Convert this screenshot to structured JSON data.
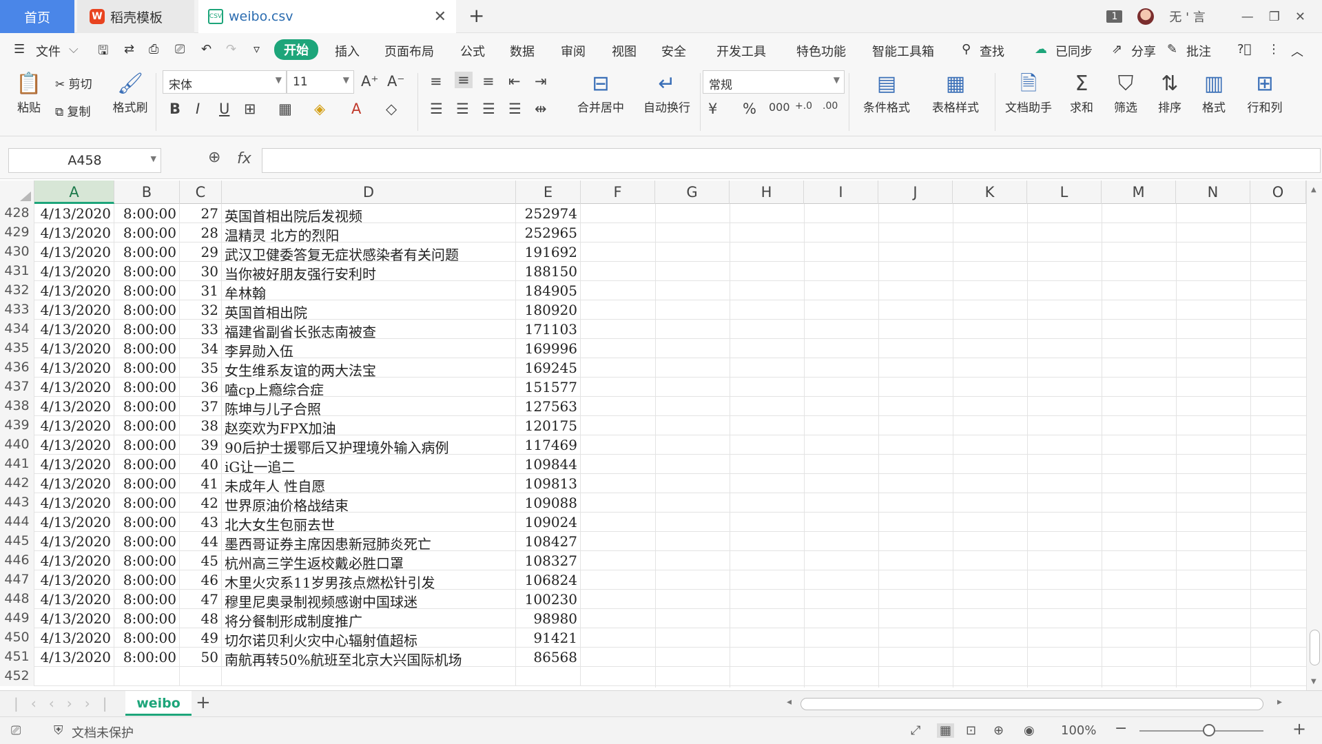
{
  "tabs": {
    "home": "首页",
    "template": "稻壳模板",
    "file": "weibo.csv"
  },
  "titlebar_right": {
    "badge": "1",
    "user": "无 ' 言"
  },
  "menu": {
    "file": "文件",
    "items": [
      "开始",
      "插入",
      "页面布局",
      "公式",
      "数据",
      "审阅",
      "视图",
      "安全",
      "开发工具",
      "特色功能",
      "智能工具箱"
    ],
    "search": "查找",
    "synced": "已同步",
    "share": "分享",
    "annotate": "批注"
  },
  "ribbon": {
    "paste": "粘贴",
    "cut": "剪切",
    "copy": "复制",
    "format_painter": "格式刷",
    "font_name": "宋体",
    "font_size": "11",
    "merge_center": "合并居中",
    "wrap": "自动换行",
    "number_format": "常规",
    "cond_format": "条件格式",
    "table_style": "表格样式",
    "doc_helper": "文档助手",
    "sum": "求和",
    "filter": "筛选",
    "sort": "排序",
    "format": "格式",
    "row_col": "行和列"
  },
  "formula": {
    "cell_ref": "A458",
    "fx": "fx",
    "value": ""
  },
  "columns": [
    "A",
    "B",
    "C",
    "D",
    "E",
    "F",
    "G",
    "H",
    "I",
    "J",
    "K",
    "L",
    "M",
    "N",
    "O"
  ],
  "rows": [
    {
      "n": "428",
      "a": "4/13/2020",
      "b": "8:00:00",
      "c": "27",
      "d": "英国首相出院后发视频",
      "e": "252974"
    },
    {
      "n": "429",
      "a": "4/13/2020",
      "b": "8:00:00",
      "c": "28",
      "d": "温精灵 北方的烈阳",
      "e": "252965"
    },
    {
      "n": "430",
      "a": "4/13/2020",
      "b": "8:00:00",
      "c": "29",
      "d": "武汉卫健委答复无症状感染者有关问题",
      "e": "191692"
    },
    {
      "n": "431",
      "a": "4/13/2020",
      "b": "8:00:00",
      "c": "30",
      "d": "当你被好朋友强行安利时",
      "e": "188150"
    },
    {
      "n": "432",
      "a": "4/13/2020",
      "b": "8:00:00",
      "c": "31",
      "d": "牟林翰",
      "e": "184905"
    },
    {
      "n": "433",
      "a": "4/13/2020",
      "b": "8:00:00",
      "c": "32",
      "d": "英国首相出院",
      "e": "180920"
    },
    {
      "n": "434",
      "a": "4/13/2020",
      "b": "8:00:00",
      "c": "33",
      "d": "福建省副省长张志南被查",
      "e": "171103"
    },
    {
      "n": "435",
      "a": "4/13/2020",
      "b": "8:00:00",
      "c": "34",
      "d": "李昇勋入伍",
      "e": "169996"
    },
    {
      "n": "436",
      "a": "4/13/2020",
      "b": "8:00:00",
      "c": "35",
      "d": "女生维系友谊的两大法宝",
      "e": "169245"
    },
    {
      "n": "437",
      "a": "4/13/2020",
      "b": "8:00:00",
      "c": "36",
      "d": "嗑cp上瘾综合症",
      "e": "151577"
    },
    {
      "n": "438",
      "a": "4/13/2020",
      "b": "8:00:00",
      "c": "37",
      "d": "陈坤与儿子合照",
      "e": "127563"
    },
    {
      "n": "439",
      "a": "4/13/2020",
      "b": "8:00:00",
      "c": "38",
      "d": "赵奕欢为FPX加油",
      "e": "120175"
    },
    {
      "n": "440",
      "a": "4/13/2020",
      "b": "8:00:00",
      "c": "39",
      "d": "90后护士援鄂后又护理境外输入病例",
      "e": "117469"
    },
    {
      "n": "441",
      "a": "4/13/2020",
      "b": "8:00:00",
      "c": "40",
      "d": "iG让一追二",
      "e": "109844"
    },
    {
      "n": "442",
      "a": "4/13/2020",
      "b": "8:00:00",
      "c": "41",
      "d": "未成年人 性自愿",
      "e": "109813"
    },
    {
      "n": "443",
      "a": "4/13/2020",
      "b": "8:00:00",
      "c": "42",
      "d": "世界原油价格战结束",
      "e": "109088"
    },
    {
      "n": "444",
      "a": "4/13/2020",
      "b": "8:00:00",
      "c": "43",
      "d": "北大女生包丽去世",
      "e": "109024"
    },
    {
      "n": "445",
      "a": "4/13/2020",
      "b": "8:00:00",
      "c": "44",
      "d": "墨西哥证券主席因患新冠肺炎死亡",
      "e": "108427"
    },
    {
      "n": "446",
      "a": "4/13/2020",
      "b": "8:00:00",
      "c": "45",
      "d": "杭州高三学生返校戴必胜口罩",
      "e": "108327"
    },
    {
      "n": "447",
      "a": "4/13/2020",
      "b": "8:00:00",
      "c": "46",
      "d": "木里火灾系11岁男孩点燃松针引发",
      "e": "106824"
    },
    {
      "n": "448",
      "a": "4/13/2020",
      "b": "8:00:00",
      "c": "47",
      "d": "穆里尼奥录制视频感谢中国球迷",
      "e": "100230"
    },
    {
      "n": "449",
      "a": "4/13/2020",
      "b": "8:00:00",
      "c": "48",
      "d": "将分餐制形成制度推广",
      "e": "98980"
    },
    {
      "n": "450",
      "a": "4/13/2020",
      "b": "8:00:00",
      "c": "49",
      "d": "切尔诺贝利火灾中心辐射值超标",
      "e": "91421"
    },
    {
      "n": "451",
      "a": "4/13/2020",
      "b": "8:00:00",
      "c": "50",
      "d": "南航再转50%航班至北京大兴国际机场",
      "e": "86568"
    },
    {
      "n": "452",
      "a": "",
      "b": "",
      "c": "",
      "d": "",
      "e": ""
    }
  ],
  "sheet": {
    "name": "weibo"
  },
  "status": {
    "protect": "文档未保护",
    "zoom": "100%"
  },
  "colors": {
    "accent": "#1da57a",
    "home_tab": "#4a86e8"
  }
}
